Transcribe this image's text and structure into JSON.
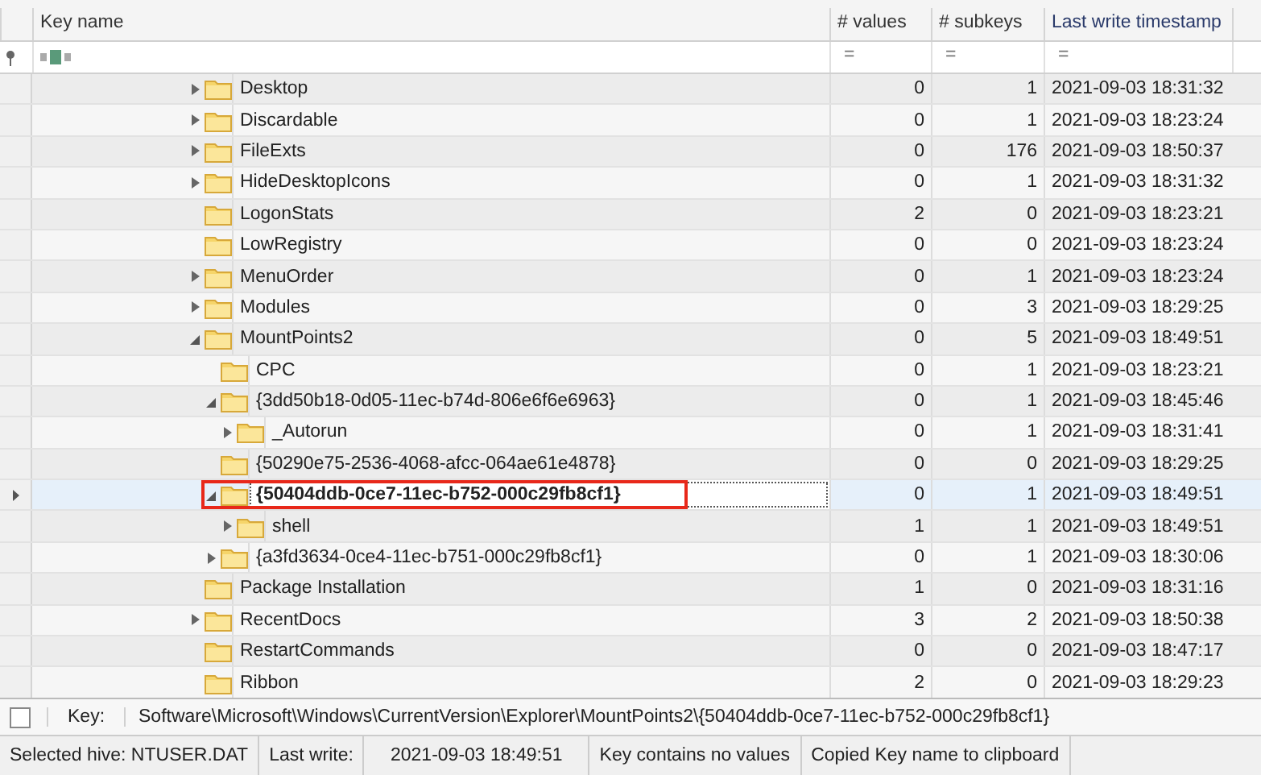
{
  "columns": [
    {
      "label": "Key name",
      "kind": "name"
    },
    {
      "label": "# values",
      "kind": "num"
    },
    {
      "label": "# subkeys",
      "kind": "num"
    },
    {
      "label": "Last write timestamp",
      "kind": "text"
    }
  ],
  "filters": [
    "=",
    "=",
    "="
  ],
  "rows": [
    {
      "name": "Desktop",
      "values": "0",
      "subkeys": "1",
      "timestamp": "2021-09-03 18:31:32",
      "expandable": true,
      "expanded": false,
      "selected": false
    },
    {
      "name": "Discardable",
      "values": "0",
      "subkeys": "1",
      "timestamp": "2021-09-03 18:23:24",
      "expandable": true,
      "expanded": false,
      "selected": false
    },
    {
      "name": "FileExts",
      "values": "0",
      "subkeys": "176",
      "timestamp": "2021-09-03 18:50:37",
      "expandable": true,
      "expanded": false,
      "selected": false
    },
    {
      "name": "HideDesktopIcons",
      "values": "0",
      "subkeys": "1",
      "timestamp": "2021-09-03 18:31:32",
      "expandable": true,
      "expanded": false,
      "selected": false
    },
    {
      "name": "LogonStats",
      "values": "2",
      "subkeys": "0",
      "timestamp": "2021-09-03 18:23:21",
      "expandable": false,
      "selected": false
    },
    {
      "name": "LowRegistry",
      "values": "0",
      "subkeys": "0",
      "timestamp": "2021-09-03 18:23:24",
      "expandable": false,
      "selected": false
    },
    {
      "name": "MenuOrder",
      "values": "0",
      "subkeys": "1",
      "timestamp": "2021-09-03 18:23:24",
      "expandable": true,
      "expanded": false,
      "selected": false
    },
    {
      "name": "Modules",
      "values": "0",
      "subkeys": "3",
      "timestamp": "2021-09-03 18:29:25",
      "expandable": true,
      "expanded": false,
      "selected": false
    },
    {
      "name": "MountPoints2",
      "values": "0",
      "subkeys": "5",
      "timestamp": "2021-09-03 18:49:51",
      "expandable": true,
      "expanded": true,
      "selected": false,
      "children": [
        {
          "name": "CPC",
          "values": "0",
          "subkeys": "1",
          "timestamp": "2021-09-03 18:23:21",
          "expandable": false,
          "selected": false
        },
        {
          "name": "{3dd50b18-0d05-11ec-b74d-806e6f6e6963}",
          "values": "0",
          "subkeys": "1",
          "timestamp": "2021-09-03 18:45:46",
          "expandable": true,
          "expanded": true,
          "selected": false,
          "children": [
            {
              "name": "_Autorun",
              "values": "0",
              "subkeys": "1",
              "timestamp": "2021-09-03 18:31:41",
              "expandable": true,
              "expanded": false,
              "selected": false
            }
          ]
        },
        {
          "name": "{50290e75-2536-4068-afcc-064ae61e4878}",
          "values": "0",
          "subkeys": "0",
          "timestamp": "2021-09-03 18:29:25",
          "expandable": false,
          "selected": false
        },
        {
          "name": "{50404ddb-0ce7-11ec-b752-000c29fb8cf1}",
          "values": "0",
          "subkeys": "1",
          "timestamp": "2021-09-03 18:49:51",
          "expandable": true,
          "expanded": true,
          "selected": true,
          "children": [
            {
              "name": "shell",
              "values": "1",
              "subkeys": "1",
              "timestamp": "2021-09-03 18:49:51",
              "expandable": true,
              "expanded": false,
              "selected": false
            }
          ]
        },
        {
          "name": "{a3fd3634-0ce4-11ec-b751-000c29fb8cf1}",
          "values": "0",
          "subkeys": "1",
          "timestamp": "2021-09-03 18:30:06",
          "expandable": true,
          "expanded": false,
          "selected": false
        }
      ]
    },
    {
      "name": "Package Installation",
      "values": "1",
      "subkeys": "0",
      "timestamp": "2021-09-03 18:31:16",
      "expandable": false,
      "selected": false
    },
    {
      "name": "RecentDocs",
      "values": "3",
      "subkeys": "2",
      "timestamp": "2021-09-03 18:50:38",
      "expandable": true,
      "expanded": false,
      "selected": false
    },
    {
      "name": "RestartCommands",
      "values": "0",
      "subkeys": "0",
      "timestamp": "2021-09-03 18:47:17",
      "expandable": false,
      "selected": false
    },
    {
      "name": "Ribbon",
      "values": "2",
      "subkeys": "0",
      "timestamp": "2021-09-03 18:29:23",
      "expandable": false,
      "selected": false
    }
  ],
  "key_bar": {
    "checked": false,
    "label": "Key:",
    "path": "Software\\Microsoft\\Windows\\CurrentVersion\\Explorer\\MountPoints2\\{50404ddb-0ce7-11ec-b752-000c29fb8cf1}"
  },
  "status_bar": [
    "Selected hive: NTUSER.DAT",
    "Last write:",
    "2021-09-03 18:49:51",
    "Key contains no values",
    "Copied Key name to clipboard"
  ]
}
